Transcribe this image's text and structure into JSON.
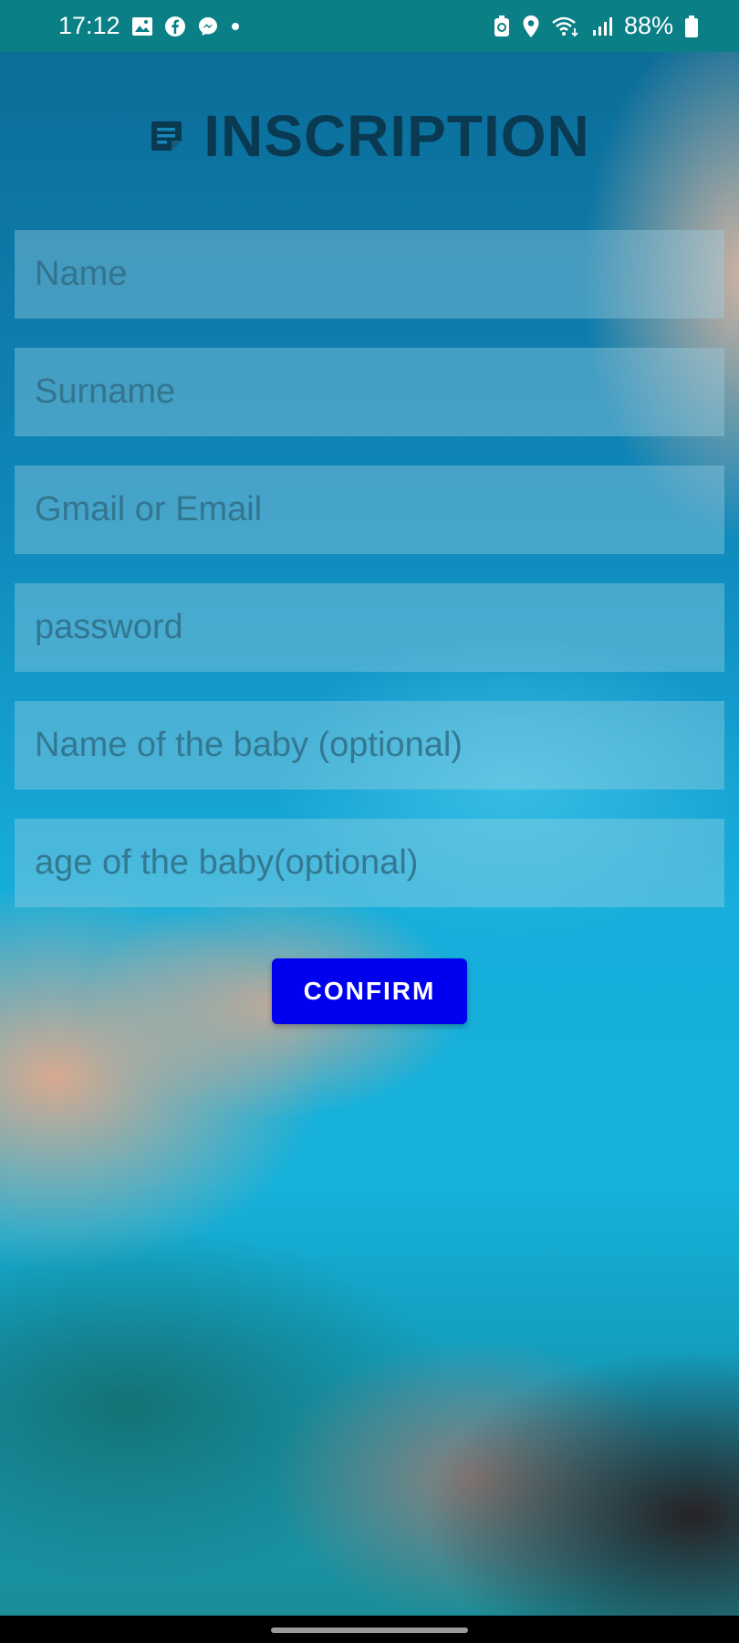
{
  "status_bar": {
    "time": "17:12",
    "battery": "88%",
    "left_icons": [
      "gallery-icon",
      "facebook-icon",
      "messenger-icon",
      "dot-icon"
    ],
    "right_icons": [
      "battery-saver-icon",
      "location-icon",
      "wifi-icon",
      "signal-icon",
      "battery-icon"
    ]
  },
  "header": {
    "title": "INSCRIPTION",
    "icon": "note-icon"
  },
  "form": {
    "fields": [
      {
        "placeholder": "Name",
        "value": ""
      },
      {
        "placeholder": "Surname",
        "value": ""
      },
      {
        "placeholder": "Gmail or Email",
        "value": ""
      },
      {
        "placeholder": "password",
        "value": ""
      },
      {
        "placeholder": "Name of the baby (optional)",
        "value": ""
      },
      {
        "placeholder": "age of the baby(optional)",
        "value": ""
      }
    ],
    "confirm_label": "CONFIRM"
  },
  "colors": {
    "status_bar_bg": "#0a7f86",
    "confirm_bg": "#0000ee",
    "title_color": "#0a3a52"
  }
}
